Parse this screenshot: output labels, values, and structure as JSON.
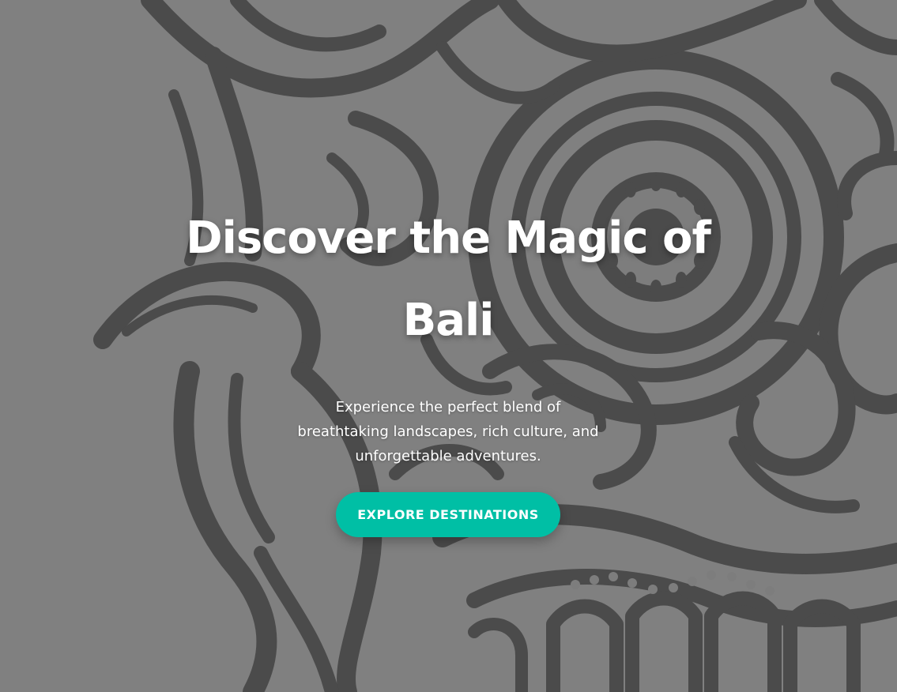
{
  "hero": {
    "title": "Discover the Magic of Bali",
    "subtitle": "Experience the perfect blend of breathtaking landscapes, rich culture, and unforgettable adventures.",
    "cta_label": "EXPLORE DESTINATIONS",
    "background_art": "balinese-barong-mask-illustration"
  },
  "colors": {
    "overlay": "#808080",
    "line_art": "#4a4a4a",
    "accent": "#00bfa5",
    "text": "#ffffff"
  }
}
